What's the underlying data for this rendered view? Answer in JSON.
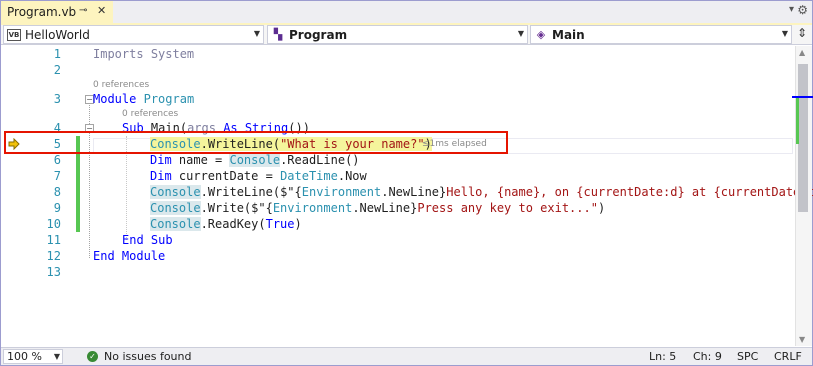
{
  "tab": {
    "title": "Program.vb",
    "pin_icon": "pin-icon",
    "close_icon": "close-icon"
  },
  "nav": {
    "project": "HelloWorld",
    "type": "Program",
    "member": "Main",
    "project_icon": "vb-project-icon",
    "type_icon": "module-icon",
    "member_icon": "method-icon"
  },
  "editor": {
    "line_numbers": [
      "1",
      "2",
      "3",
      "4",
      "5",
      "6",
      "7",
      "8",
      "9",
      "10",
      "11",
      "12",
      "13"
    ],
    "codelens_module": "0 references",
    "codelens_sub": "0 references",
    "elapsed": "≤1ms elapsed",
    "lines": {
      "l1": [
        "Imports",
        " ",
        "System"
      ],
      "l3": [
        "Module",
        " ",
        "Program"
      ],
      "l4": [
        "Sub",
        " ",
        "Main",
        "(",
        "args",
        " ",
        "As",
        " ",
        "String",
        "())"
      ],
      "l5": [
        "Console",
        ".",
        "WriteLine",
        "(",
        "\"What is your name?\"",
        ")"
      ],
      "l6": [
        "Dim",
        " name = ",
        "Console",
        ".ReadLine()"
      ],
      "l7": [
        "Dim",
        " currentDate = ",
        "DateTime",
        ".Now"
      ],
      "l8": [
        "Console",
        ".",
        "WriteLine",
        "($\"{",
        "Environment",
        ".NewLine}",
        "Hello, {name}, on {currentDate:d} at {currentDate:t"
      ],
      "l9": [
        "Console",
        ".Write($\"{",
        "Environment",
        ".NewLine}",
        "Press any key to exit...\"",
        ")"
      ],
      "l10": [
        "Console",
        ".ReadKey(",
        "True",
        ")"
      ],
      "l11": [
        "End Sub"
      ],
      "l12": [
        "End Module"
      ]
    }
  },
  "statusbar": {
    "zoom": "100 %",
    "issues": "No issues found",
    "line": "Ln: 5",
    "col": "Ch: 9",
    "spacing": "SPC",
    "eol": "CRLF"
  },
  "colors": {
    "keyword": "#0000ff",
    "type": "#2b91af",
    "string": "#a31515",
    "changed_bar": "#57c752",
    "breakpoint_box": "#e51400",
    "statement_highlight": "#f5f59c"
  }
}
